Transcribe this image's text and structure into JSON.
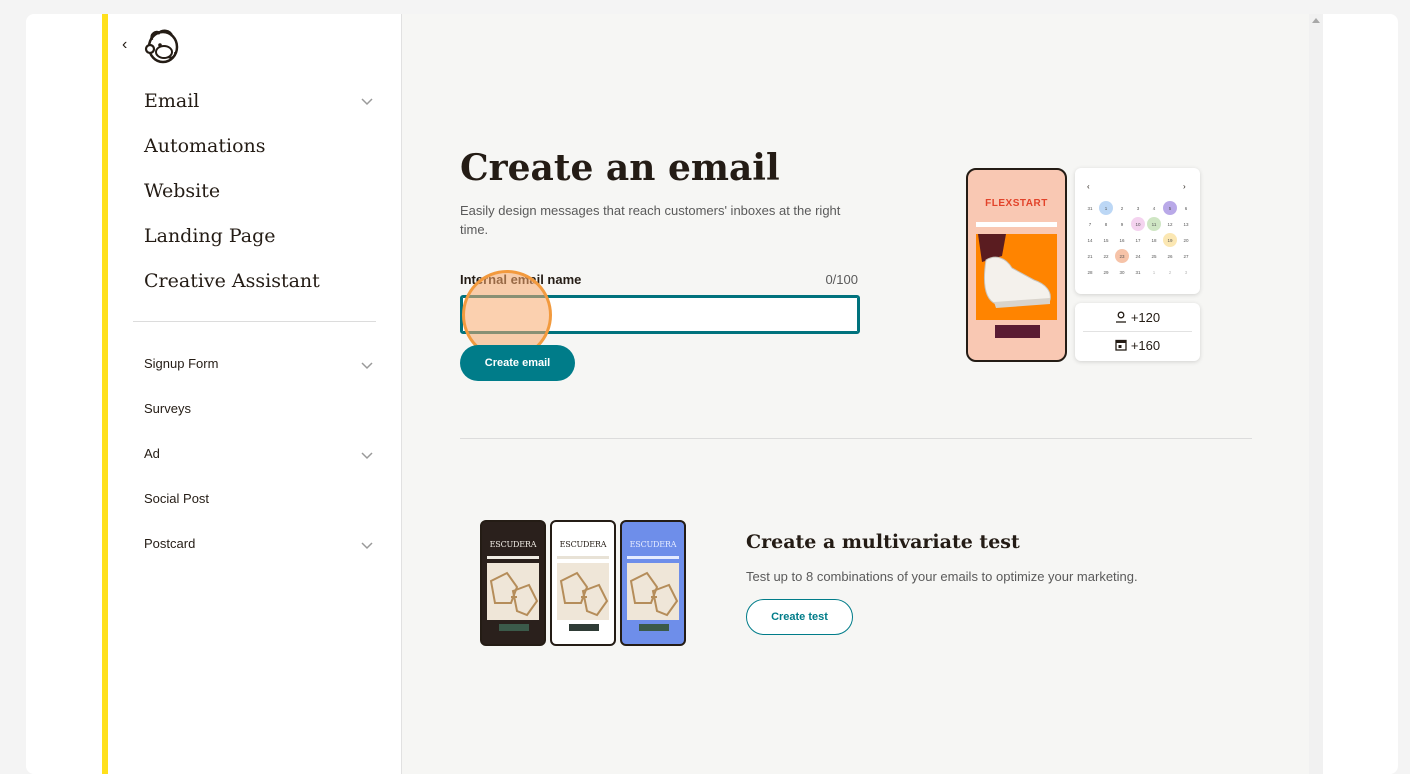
{
  "sidebar": {
    "back_label": "‹",
    "primary_items": [
      {
        "label": "Email",
        "has_chevron": true
      },
      {
        "label": "Automations",
        "has_chevron": false
      },
      {
        "label": "Website",
        "has_chevron": false
      },
      {
        "label": "Landing Page",
        "has_chevron": false
      },
      {
        "label": "Creative Assistant",
        "has_chevron": false
      }
    ],
    "secondary_items": [
      {
        "label": "Signup Form",
        "has_chevron": true
      },
      {
        "label": "Surveys",
        "has_chevron": false
      },
      {
        "label": "Ad",
        "has_chevron": true
      },
      {
        "label": "Social Post",
        "has_chevron": false
      },
      {
        "label": "Postcard",
        "has_chevron": true
      }
    ]
  },
  "main": {
    "title": "Create an email",
    "subtitle": "Easily design messages that reach customers' inboxes at the right time.",
    "field_label": "Internal email name",
    "counter": "0/100",
    "input_value": "",
    "create_button": "Create email",
    "illustration": {
      "brand": "FLEXSTART",
      "stat_opens": "+120",
      "stat_clicks": "+160",
      "calendar_prev": "‹",
      "calendar_next": "›"
    },
    "multivariate": {
      "title": "Create a multivariate test",
      "description": "Test up to 8 combinations of your emails to optimize your marketing.",
      "button": "Create test",
      "brand": "ESCUDERA"
    }
  },
  "colors": {
    "accent_yellow": "#ffe01b",
    "teal": "#007c89",
    "highlight_orange": "#f29a3e"
  }
}
